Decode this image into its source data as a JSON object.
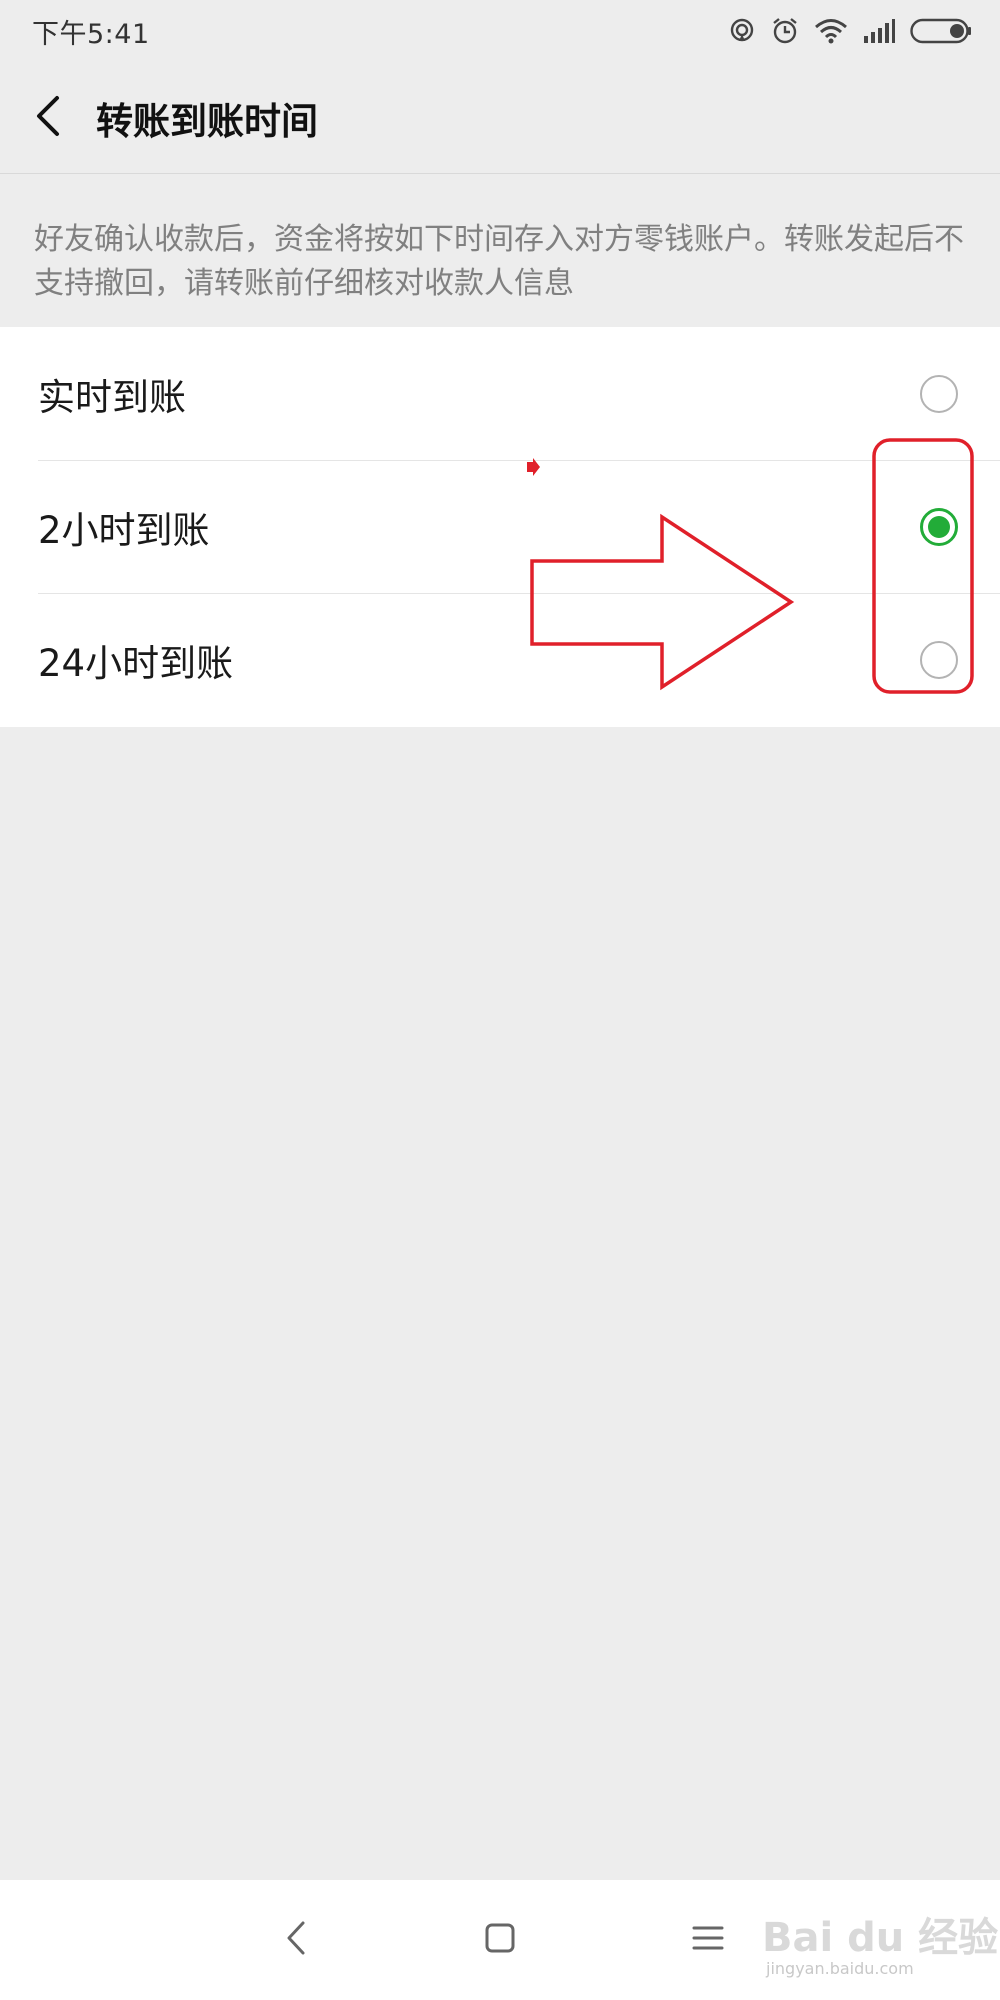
{
  "status_bar": {
    "time": "下午5:41",
    "icons": [
      "hotspot-icon",
      "alarm-icon",
      "wifi-icon",
      "signal-icon",
      "battery-icon"
    ]
  },
  "nav": {
    "back_icon": "chevron-left-icon",
    "title": "转账到账时间"
  },
  "description": {
    "text": "好友确认收款后，资金将按如下时间存入对方零钱账户。转账发起后不支持撤回，请转账前仔细核对收款人信息"
  },
  "options": [
    {
      "label": "实时到账",
      "selected": false
    },
    {
      "label": "2小时到账",
      "selected": true
    },
    {
      "label": "24小时到账",
      "selected": false
    }
  ],
  "colors": {
    "accent_green": "#22ac38",
    "annotation_red": "#e0202a",
    "page_bg": "#ededed"
  },
  "bottom_nav": {
    "back_icon": "back-triangle-icon",
    "home_icon": "home-square-icon",
    "menu_icon": "menu-lines-icon"
  },
  "watermark": {
    "text": "Bai du 经验",
    "sub": "jingyan.baidu.com"
  }
}
